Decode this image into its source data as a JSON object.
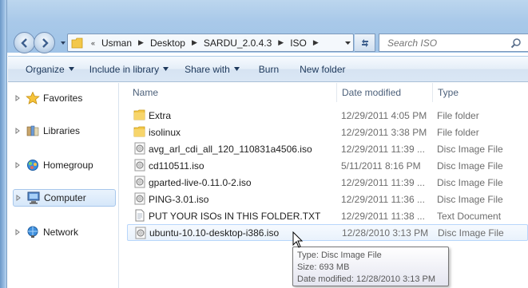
{
  "address": {
    "overflow": "«",
    "crumbs": [
      "Usman",
      "Desktop",
      "SARDU_2.0.4.3",
      "ISO"
    ]
  },
  "search": {
    "placeholder": "Search ISO"
  },
  "toolbar": {
    "organize": "Organize",
    "include": "Include in library",
    "share": "Share with",
    "burn": "Burn",
    "new_folder": "New folder"
  },
  "nav": {
    "items": [
      {
        "label": "Favorites",
        "icon": "star-icon"
      },
      {
        "label": "Libraries",
        "icon": "libraries-icon"
      },
      {
        "label": "Homegroup",
        "icon": "homegroup-icon"
      },
      {
        "label": "Computer",
        "icon": "computer-icon"
      },
      {
        "label": "Network",
        "icon": "network-icon"
      }
    ]
  },
  "columns": {
    "name": "Name",
    "date": "Date modified",
    "type": "Type"
  },
  "files": [
    {
      "name": "Extra",
      "date": "12/29/2011 4:05 PM",
      "type": "File folder",
      "icon": "folder-icon"
    },
    {
      "name": "isolinux",
      "date": "12/29/2011 3:38 PM",
      "type": "File folder",
      "icon": "folder-icon"
    },
    {
      "name": "avg_arl_cdi_all_120_110831a4506.iso",
      "date": "12/29/2011 11:39 ...",
      "type": "Disc Image File",
      "icon": "disc-image-icon"
    },
    {
      "name": "cd110511.iso",
      "date": "5/11/2011 8:16 PM",
      "type": "Disc Image File",
      "icon": "disc-image-icon"
    },
    {
      "name": "gparted-live-0.11.0-2.iso",
      "date": "12/29/2011 11:39 ...",
      "type": "Disc Image File",
      "icon": "disc-image-icon"
    },
    {
      "name": "PING-3.01.iso",
      "date": "12/29/2011 11:36 ...",
      "type": "Disc Image File",
      "icon": "disc-image-icon"
    },
    {
      "name": "PUT YOUR ISOs IN THIS FOLDER.TXT",
      "date": "12/29/2011 11:38 ...",
      "type": "Text Document",
      "icon": "text-document-icon"
    },
    {
      "name": "ubuntu-10.10-desktop-i386.iso",
      "date": "12/28/2010 3:13 PM",
      "type": "Disc Image File",
      "icon": "disc-image-icon"
    }
  ],
  "tooltip": {
    "type": "Type: Disc Image File",
    "size": "Size: 693 MB",
    "date": "Date modified: 12/28/2010 3:13 PM"
  },
  "colors": {
    "accent": "#1e395b",
    "selection": "#d5e7fa",
    "folder": "#f3c84a"
  }
}
